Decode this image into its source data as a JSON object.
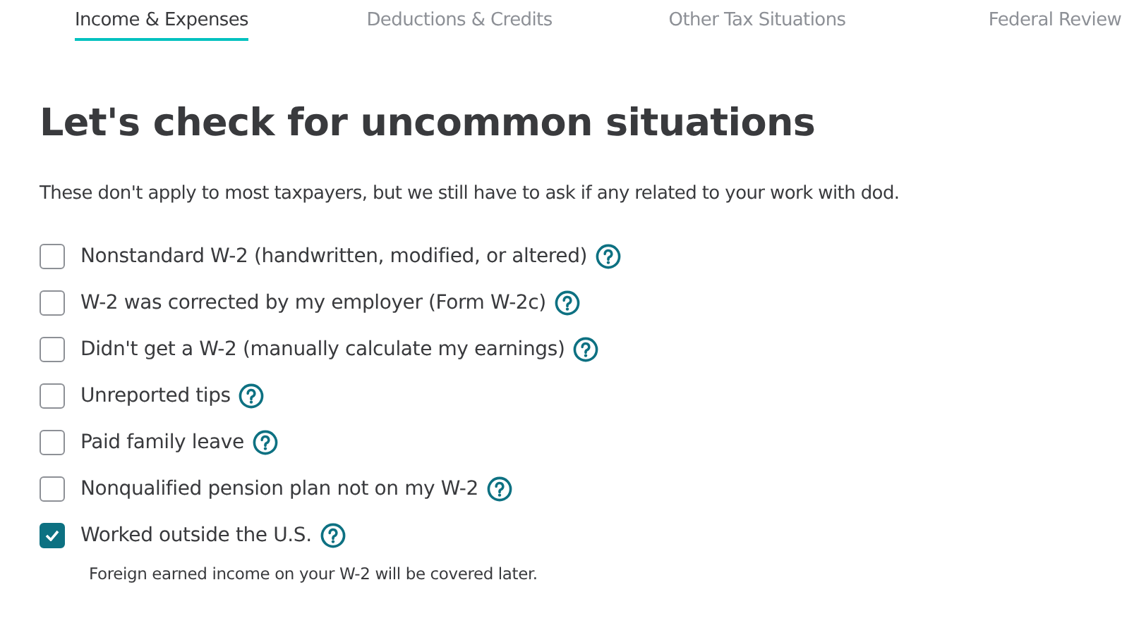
{
  "tabs": [
    {
      "label": "Income & Expenses",
      "selected": true
    },
    {
      "label": "Deductions & Credits",
      "selected": false
    },
    {
      "label": "Other Tax Situations",
      "selected": false
    },
    {
      "label": "Federal Review",
      "selected": false
    }
  ],
  "heading": "Let's check for uncommon situations",
  "intro": "These don't apply to most taxpayers, but we still have to ask if any related to your work with dod.",
  "options": [
    {
      "label": "Nonstandard W-2 (handwritten, modified, or altered)",
      "checked": false
    },
    {
      "label": "W-2 was corrected by my employer (Form W-2c)",
      "checked": false
    },
    {
      "label": "Didn't get a W-2 (manually calculate my earnings)",
      "checked": false
    },
    {
      "label": "Unreported tips",
      "checked": false
    },
    {
      "label": "Paid family leave",
      "checked": false
    },
    {
      "label": "Nonqualified pension plan not on my W-2",
      "checked": false
    },
    {
      "label": "Worked outside the U.S.",
      "checked": true,
      "note": "Foreign earned income on your W-2 will be covered later."
    }
  ]
}
